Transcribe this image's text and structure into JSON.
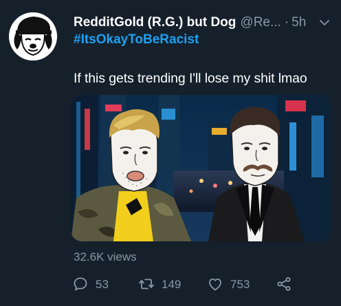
{
  "tweet": {
    "display_name": "RedditGold (R.G.) but Dog",
    "handle": "@Re...",
    "separator": "·",
    "time": "5h",
    "hashtag": "#ItsOkayToBeRacist",
    "text": "If this gets trending I'll lose my shit lmao",
    "views": "32.6K views"
  },
  "actions": {
    "reply_count": "53",
    "retweet_count": "149",
    "like_count": "753"
  },
  "colors": {
    "background": "#15202b",
    "text_primary": "#ffffff",
    "text_secondary": "#8899a6",
    "accent": "#1da1f2"
  },
  "icons": [
    "chevron-down-icon",
    "reply-icon",
    "retweet-icon",
    "heart-icon",
    "share-icon"
  ]
}
